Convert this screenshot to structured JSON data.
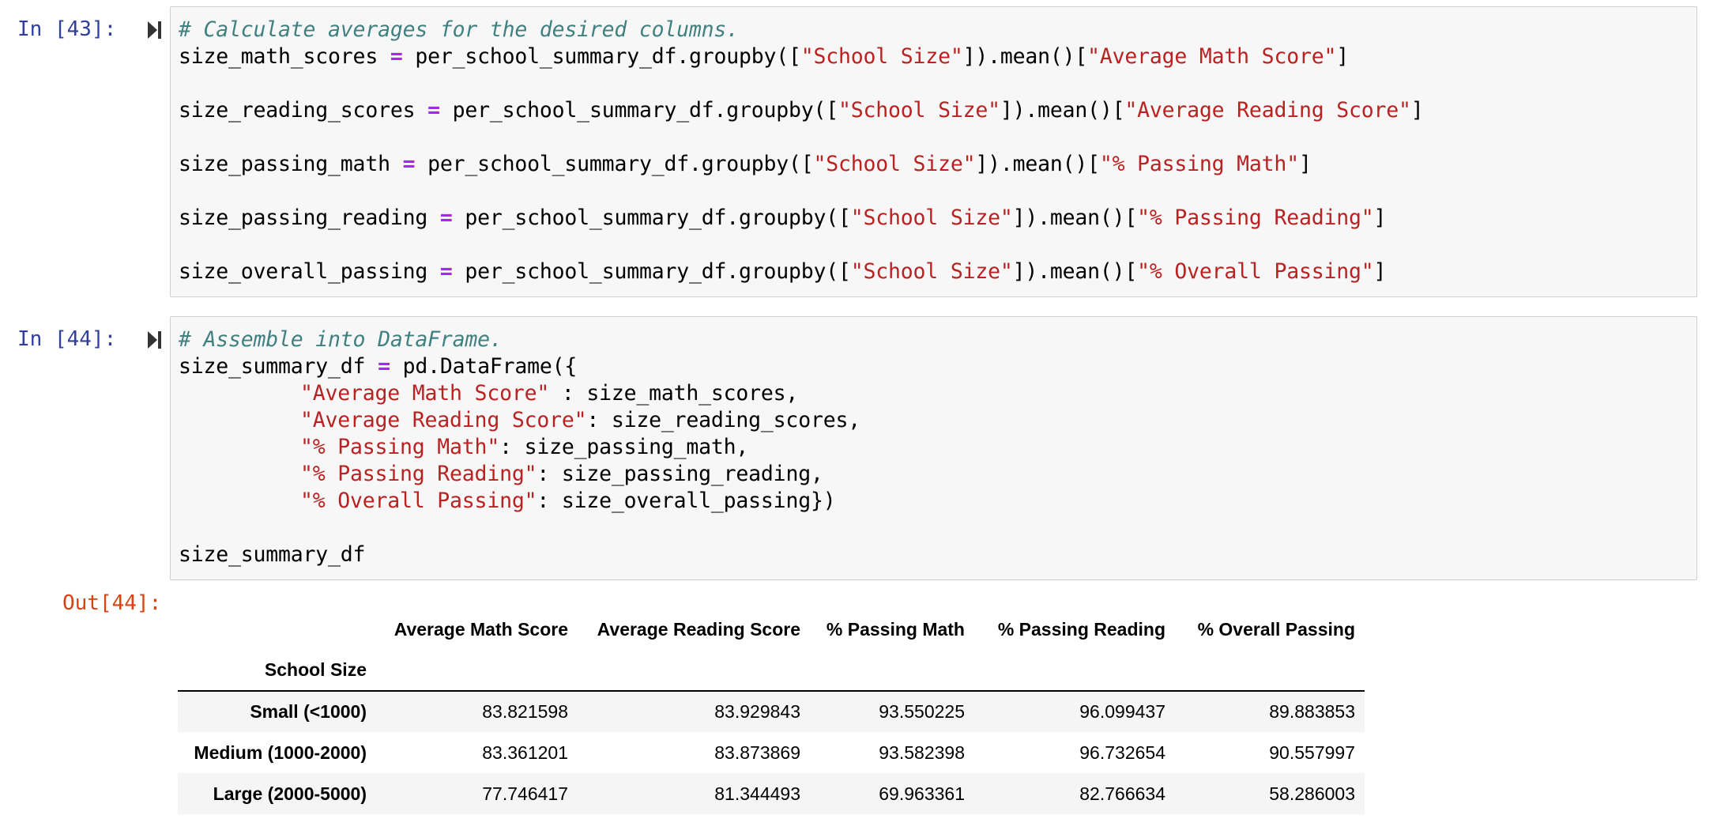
{
  "cells": [
    {
      "prompt": "In [43]:",
      "lines": [
        {
          "comment": "# Calculate averages for the desired columns."
        },
        {
          "var": "size_math_scores",
          "op": "=",
          "call": "per_school_summary_df.groupby([",
          "key": "\"School Size\"",
          "mid": "]).mean()[",
          "col": "\"Average Math Score\"",
          "end": "]"
        },
        {
          "var": "size_reading_scores",
          "op": "=",
          "call": "per_school_summary_df.groupby([",
          "key": "\"School Size\"",
          "mid": "]).mean()[",
          "col": "\"Average Reading Score\"",
          "end": "]"
        },
        {
          "var": "size_passing_math",
          "op": "=",
          "call": "per_school_summary_df.groupby([",
          "key": "\"School Size\"",
          "mid": "]).mean()[",
          "col": "\"% Passing Math\"",
          "end": "]"
        },
        {
          "var": "size_passing_reading",
          "op": "=",
          "call": "per_school_summary_df.groupby([",
          "key": "\"School Size\"",
          "mid": "]).mean()[",
          "col": "\"% Passing Reading\"",
          "end": "]"
        },
        {
          "var": "size_overall_passing",
          "op": "=",
          "call": "per_school_summary_df.groupby([",
          "key": "\"School Size\"",
          "mid": "]).mean()[",
          "col": "\"% Overall Passing\"",
          "end": "]"
        }
      ]
    },
    {
      "prompt": "In [44]:",
      "comment": "# Assemble into DataFrame.",
      "assign_var": "size_summary_df",
      "assign_op": "=",
      "assign_call": "pd.DataFrame({",
      "entries": [
        {
          "key": "\"Average Math Score\"",
          "sep": " : ",
          "val": "size_math_scores,"
        },
        {
          "key": "\"Average Reading Score\"",
          "sep": ": ",
          "val": "size_reading_scores,"
        },
        {
          "key": "\"% Passing Math\"",
          "sep": ": ",
          "val": "size_passing_math,"
        },
        {
          "key": "\"% Passing Reading\"",
          "sep": ": ",
          "val": "size_passing_reading,"
        },
        {
          "key": "\"% Overall Passing\"",
          "sep": ": ",
          "val": "size_overall_passing})"
        }
      ],
      "last_line": "size_summary_df"
    }
  ],
  "output": {
    "prompt": "Out[44]:",
    "columns": [
      "Average Math Score",
      "Average Reading Score",
      "% Passing Math",
      "% Passing Reading",
      "% Overall Passing"
    ],
    "index_name": "School Size",
    "rows": [
      {
        "index": "Small (<1000)",
        "values": [
          "83.821598",
          "83.929843",
          "93.550225",
          "96.099437",
          "89.883853"
        ]
      },
      {
        "index": "Medium (1000-2000)",
        "values": [
          "83.361201",
          "83.873869",
          "93.582398",
          "96.732654",
          "90.557997"
        ]
      },
      {
        "index": "Large (2000-5000)",
        "values": [
          "77.746417",
          "81.344493",
          "69.963361",
          "82.766634",
          "58.286003"
        ]
      }
    ]
  }
}
